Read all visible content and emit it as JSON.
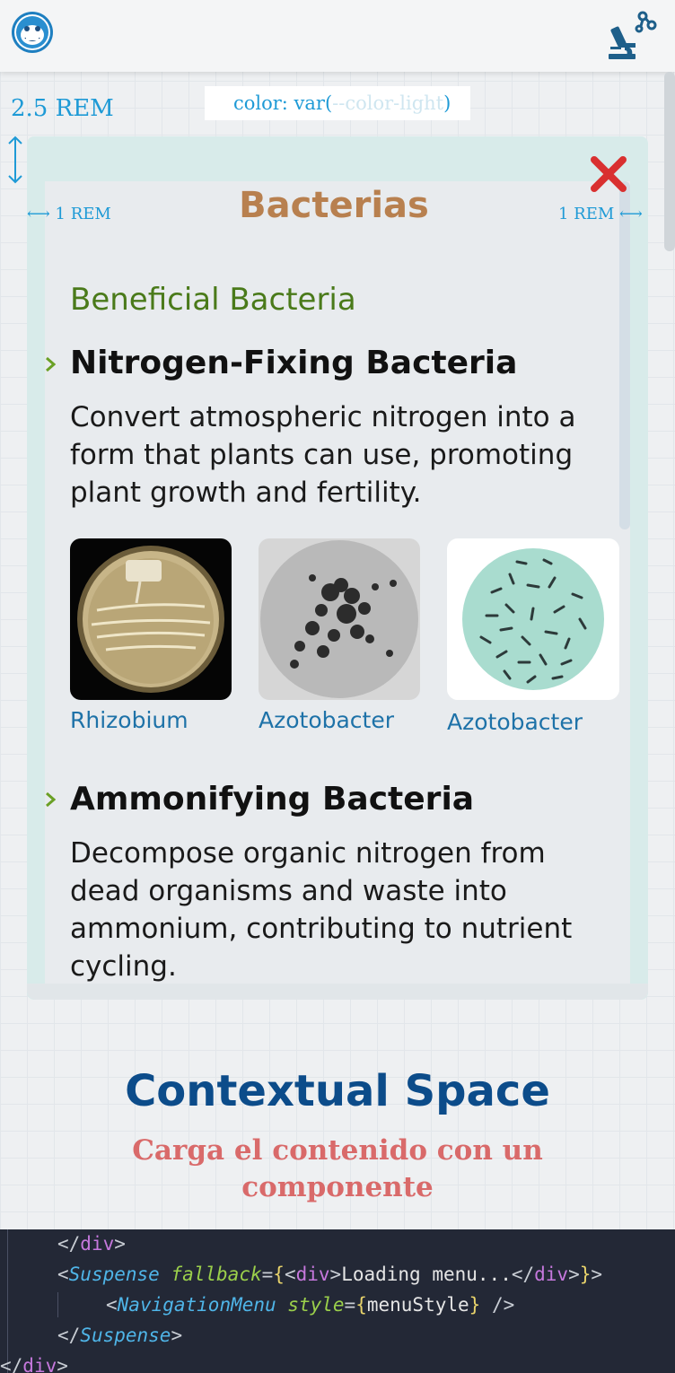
{
  "header": {
    "logo_icon": "monkey-astronaut-icon",
    "lab_icon": "microscope-icon"
  },
  "annotations": {
    "top_spacing": "2.5 REM",
    "css_note_prefix": "color: var(",
    "css_note_var": "--color-light",
    "css_note_suffix": ")",
    "left_padding": "1 REM",
    "right_padding": "1 REM"
  },
  "modal": {
    "title": "Bacterias",
    "close_icon": "close-x-icon",
    "close_color": "#d93030",
    "section_title": "Beneficial Bacteria",
    "items": [
      {
        "title": "Nitrogen-Fixing Bacteria",
        "description": "Convert atmospheric nitrogen into a form that plants can use, promoting plant growth and fertility.",
        "images": [
          {
            "caption": "Rhizobium"
          },
          {
            "caption": "Azotobacter"
          },
          {
            "caption": "Azotobacter"
          }
        ]
      },
      {
        "title": "Ammonifying Bacteria",
        "description": "Decompose organic nitrogen from dead organisms and waste into ammonium, contributing to nutrient cycling."
      }
    ]
  },
  "contextual": {
    "title": "Contextual Space",
    "subtitle": "Carga el contenido con un componente"
  },
  "code": {
    "line1_close": "div",
    "line2_tag": "Suspense",
    "line2_attr": "fallback",
    "line2_inner_tag": "div",
    "line2_text": "Loading menu...",
    "line3_tag": "NavigationMenu",
    "line3_attr": "style",
    "line3_value": "menuStyle",
    "line4_close": "Suspense",
    "line5_close": "div"
  },
  "colors": {
    "title": "#b8804f",
    "section": "#4a7a1a",
    "accent": "#1e9ad6",
    "contextual_title": "#0c4c8a",
    "contextual_subtitle": "#d96a6a"
  }
}
